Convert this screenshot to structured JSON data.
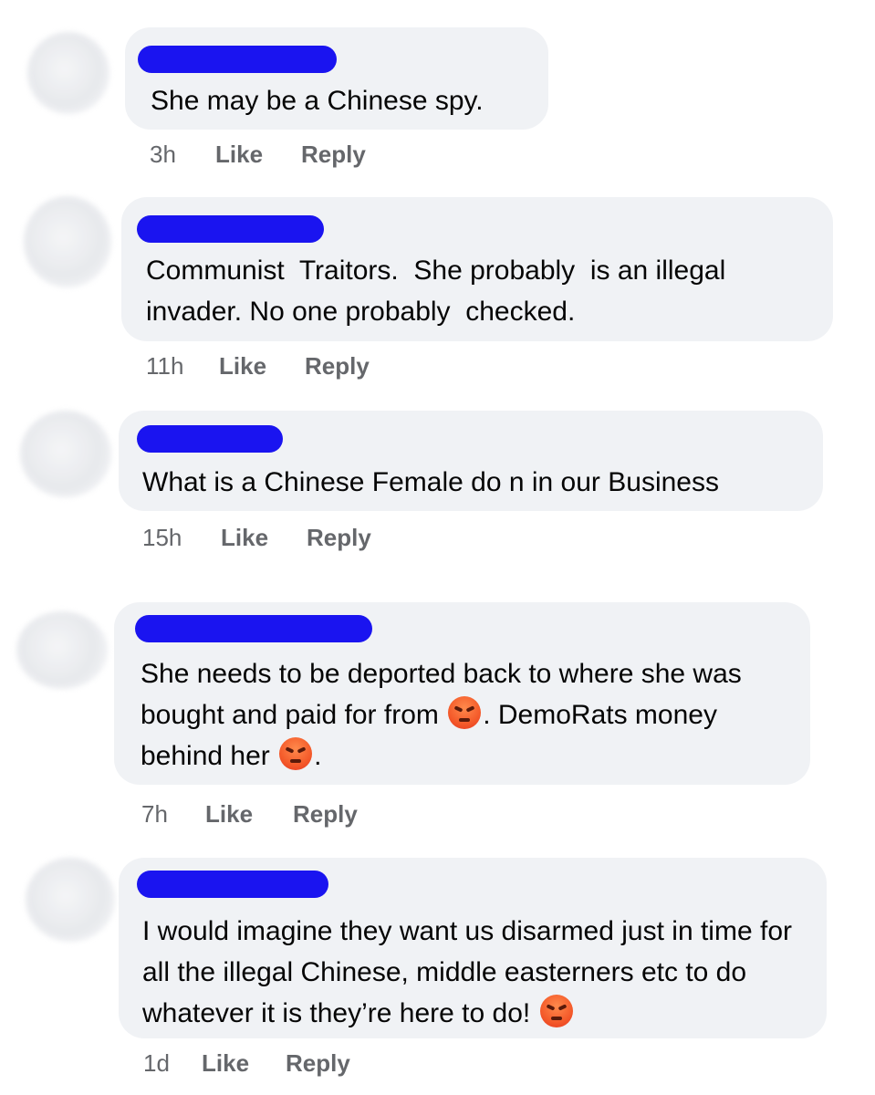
{
  "comments": [
    {
      "text": "She may be a Chinese spy.",
      "time": "3h",
      "like": "Like",
      "reply": "Reply"
    },
    {
      "text": "Communist  Traitors.  She probably  is an illegal invader. No one probably  checked.",
      "time": "11h",
      "like": "Like",
      "reply": "Reply"
    },
    {
      "text": "What is a Chinese Female do n in our Business",
      "time": "15h",
      "like": "Like",
      "reply": "Reply"
    },
    {
      "text_parts": [
        "She needs to be deported back to where she was bought and paid for from ",
        ". DemoRats money behind her ",
        "."
      ],
      "time": "7h",
      "like": "Like",
      "reply": "Reply"
    },
    {
      "text": "I would imagine they want us disarmed just in time for all the illegal Chinese, middle easterners etc to do whatever it is they’re here to do! ",
      "time": "1d",
      "like": "Like",
      "reply": "Reply"
    }
  ],
  "colors": {
    "bubble": "#f0f2f5",
    "redaction": "#1a14f0",
    "meta_text": "#65676b",
    "body_text": "#050505"
  },
  "icons": {
    "emoji": "angry-face-icon"
  }
}
